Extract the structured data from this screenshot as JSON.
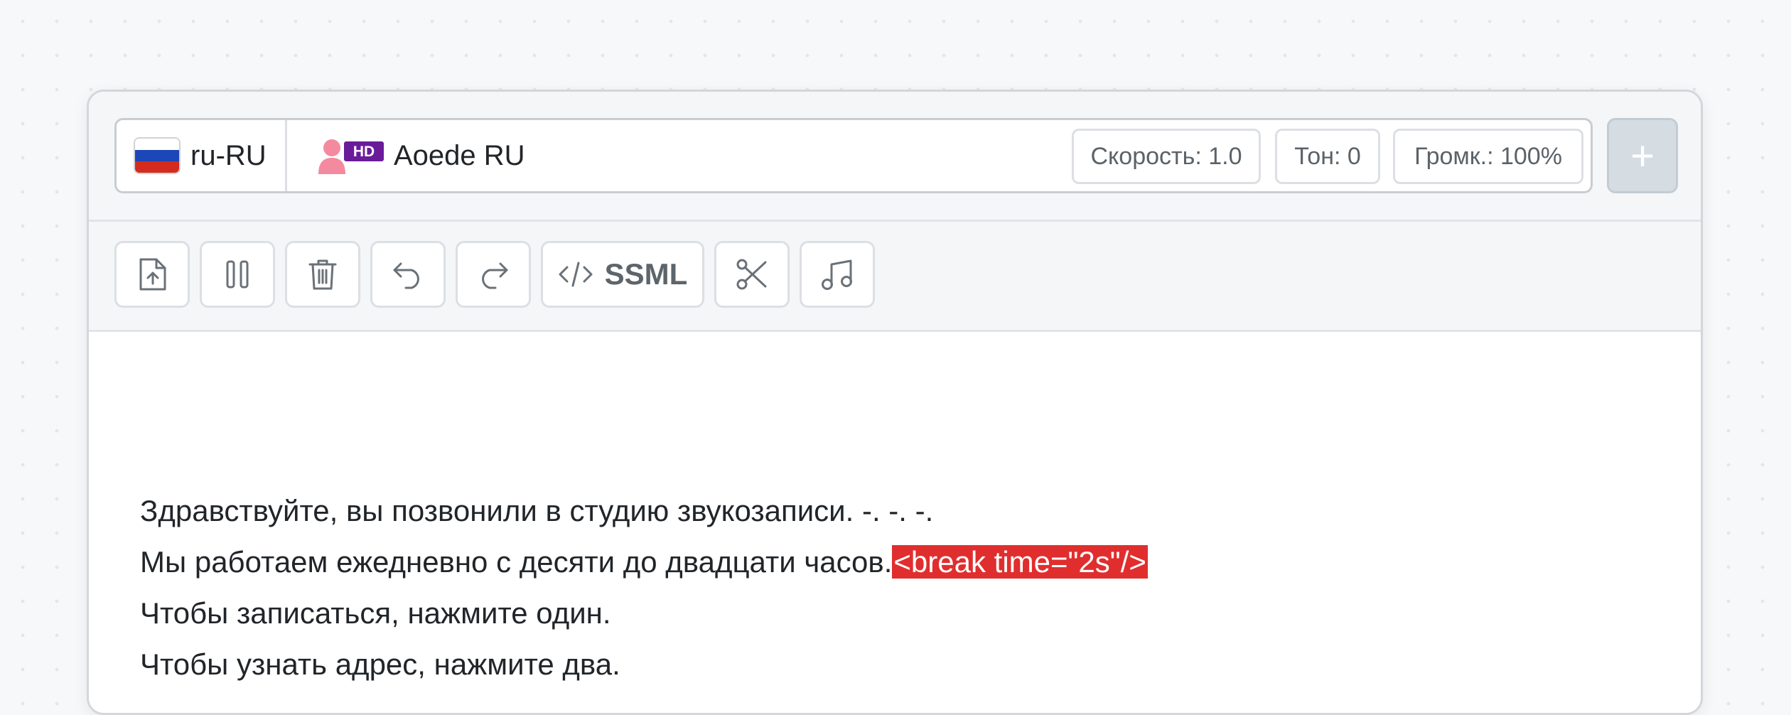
{
  "voice_bar": {
    "language": "ru-RU",
    "voice_badge": "HD",
    "voice_name": "Aoede RU",
    "speed": "Скорость: 1.0",
    "tone": "Тон: 0",
    "volume": "Громк.: 100%",
    "add_button": "+"
  },
  "toolbar": {
    "ssml_label": "SSML",
    "icons": [
      "upload-file-icon",
      "pause-icon",
      "trash-icon",
      "undo-icon",
      "redo-icon",
      "code-icon",
      "scissors-icon",
      "music-note-icon"
    ]
  },
  "editor": {
    "lines": [
      "Здравствуйте, вы позвонили в студию звукозаписи. -. -. -.",
      "Мы работаем ежедневно с десяти до двадцати часов.",
      "Чтобы записаться, нажмите один.",
      "Чтобы узнать адрес, нажмите два."
    ],
    "ssml_tag": "<break time=\"2s\"/>"
  },
  "colors": {
    "ssml_highlight": "#e02e2e",
    "hd_badge": "#6a1b9a",
    "avatar": "#f48aa0",
    "flag_white": "#ffffff",
    "flag_blue": "#1c47b8",
    "flag_red": "#d52b1e"
  }
}
